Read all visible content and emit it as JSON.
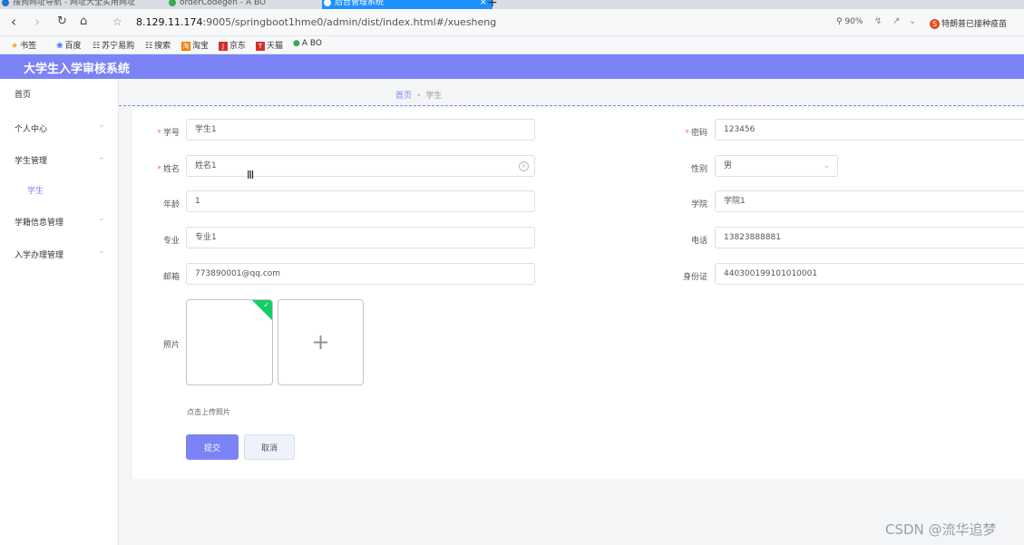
{
  "browser": {
    "tabs": [
      {
        "label": "搜狗网址导航 - 网址大全实用网址"
      },
      {
        "label": "orderCodegen - A BO"
      },
      {
        "label": "后台管理系统"
      }
    ],
    "new_tab": "+",
    "close_tab": "×",
    "url_host": "8.129.11.174",
    "url_path": ":9005/springboot1hme0/admin/dist/index.html#/xuesheng",
    "zoom": "90%",
    "news": "特朗普已接种疫苗",
    "bookmarks": [
      "书签",
      "百度",
      "苏宁易购",
      "搜索",
      "淘宝",
      "京东",
      "天猫",
      "A BO"
    ]
  },
  "app": {
    "title": "大学生入学审核系统"
  },
  "sidebar": {
    "home": "首页",
    "items": [
      {
        "label": "个人中心"
      },
      {
        "label": "学生管理"
      },
      {
        "label": "学籍信息管理"
      },
      {
        "label": "入学办理管理"
      }
    ],
    "sub_item": "学生"
  },
  "breadcrumb": {
    "home": "首页",
    "current": "学生"
  },
  "form": {
    "student_id": {
      "label": "学号",
      "value": "学生1"
    },
    "password": {
      "label": "密码",
      "value": "123456"
    },
    "name": {
      "label": "姓名",
      "value": "姓名1"
    },
    "gender": {
      "label": "性别",
      "value": "男"
    },
    "age": {
      "label": "年龄",
      "value": "1"
    },
    "college": {
      "label": "学院",
      "value": "学院1"
    },
    "major": {
      "label": "专业",
      "value": "专业1"
    },
    "phone": {
      "label": "电话",
      "value": "13823888881"
    },
    "email": {
      "label": "邮箱",
      "value": "773890001@qq.com"
    },
    "id_card": {
      "label": "身份证",
      "value": "440300199101010001"
    },
    "photo": {
      "label": "照片",
      "hint": "点击上传照片"
    }
  },
  "buttons": {
    "submit": "提交",
    "cancel": "取消"
  },
  "watermark": "CSDN @流华追梦"
}
